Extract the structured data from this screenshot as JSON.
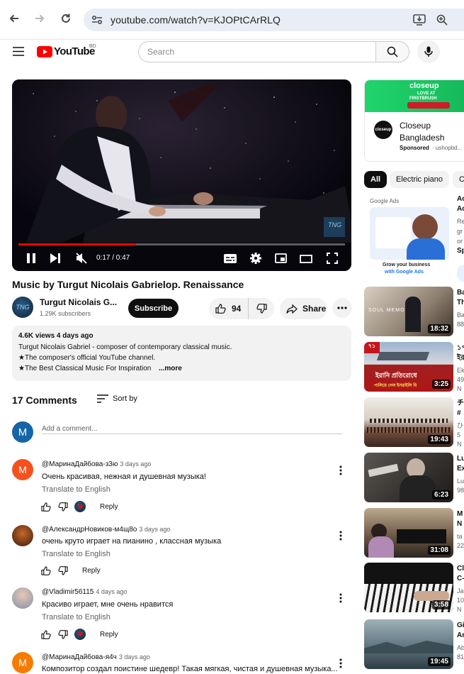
{
  "browser": {
    "url": "youtube.com/watch?v=KJOPtCArRLQ"
  },
  "header": {
    "logo_text": "YouTube",
    "region": "BD",
    "search_placeholder": "Search"
  },
  "player": {
    "time": "0:17 / 0:47",
    "progress": 0.36,
    "watermark": "TNG"
  },
  "video": {
    "title": "Music by Turgut Nicolais Gabrielop. Renaissance",
    "channel_name": "Turgut Nicolais G...",
    "channel_avatar_text": "TNG",
    "subscribers": "1.29K subscribers",
    "subscribe_label": "Subscribe",
    "likes": "94",
    "share_label": "Share"
  },
  "description": {
    "meta": "4.6K views  4 days ago",
    "line1": "Turgut Nicolais Gabriel - composer of contemporary classical music.",
    "line2": "★The composer's official YouTube channel.",
    "line3": "★The Best Classical Music For Inspiration",
    "more": "...more"
  },
  "comments": {
    "count_label": "17 Comments",
    "sort_label": "Sort by",
    "add_placeholder": "Add a comment...",
    "user_initial": "M",
    "items": [
      {
        "initial": "M",
        "name": "@МаринаДайбова-з3ю",
        "age": "3 days ago",
        "text": "Очень красивая, нежная и душевная музыка!",
        "translate": "Translate to English",
        "reply": "Reply"
      },
      {
        "initial": "",
        "name": "@АлександрНовиков-м4щ8о",
        "age": "3 days ago",
        "text": "очень круто играет на пианино , классная музыка",
        "translate": "Translate to English",
        "reply": "Reply"
      },
      {
        "initial": "",
        "name": "@Vladimir56115",
        "age": "4 days ago",
        "text": "Красиво играет, мне очень нравится",
        "translate": "Translate to English",
        "reply": "Reply"
      },
      {
        "initial": "M",
        "name": "@МаринаДайбова-я4ч",
        "age": "3 days ago",
        "text": "Композитор создал поистине шедевр! Такая мягкая, чистая и душевная музыка...",
        "translate": "",
        "reply": ""
      }
    ]
  },
  "sidebar": {
    "ad": {
      "banner_brand": "closeup",
      "banner_line1": "LOVE AT",
      "banner_line2": "FIRSTBRUSH",
      "logo_text": "closeup",
      "title_line1": "Closeup",
      "title_line2": "Bangladesh",
      "sponsored": "Sponsored",
      "advertiser": "· ushopbd..."
    },
    "chips": [
      "All",
      "Electric piano",
      "C"
    ],
    "google_ads": {
      "brand": "Google Ads",
      "caption_line1": "Grow your business",
      "caption_line2": "with Google Ads",
      "right_text": [
        "Ac",
        "Ac",
        "Re",
        "gr",
        "or",
        "Sp"
      ]
    },
    "videos": [
      {
        "duration": "18:32",
        "thumb_text": "SOUL MEMORY",
        "title": [
          "Ba",
          "Th"
        ],
        "meta": [
          "Ba",
          "88"
        ]
      },
      {
        "duration": "3:25",
        "thumb_text": "ইরানি প্রতিরোধে",
        "thumb_text2": "পালিয়ে গেল ইসরাইলি বি",
        "title": [
          "১৭",
          "ইর"
        ],
        "meta": [
          "Ek",
          "49",
          "N"
        ]
      },
      {
        "duration": "19:43",
        "title": [
          "チ",
          "#"
        ],
        "meta": [
          "ひ",
          "5",
          "N"
        ]
      },
      {
        "duration": "6:23",
        "title": [
          "Lu",
          "Ex"
        ],
        "meta": [
          "Lu",
          "98"
        ]
      },
      {
        "duration": "31:08",
        "title": [
          "M",
          "N"
        ],
        "meta": [
          "ta",
          "22"
        ]
      },
      {
        "duration": "3:58",
        "title": [
          "Cl",
          "C-"
        ],
        "meta": [
          "Ja",
          "10",
          "N"
        ]
      },
      {
        "duration": "19:45",
        "title": [
          "Gi",
          "An"
        ],
        "meta": [
          "Ab",
          "81"
        ]
      }
    ]
  }
}
